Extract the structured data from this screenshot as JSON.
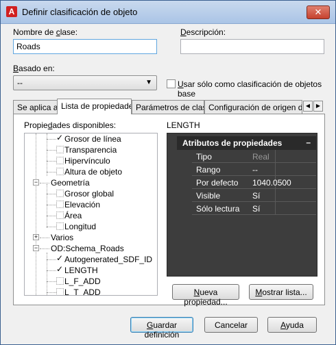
{
  "title": "Definir clasificación de objeto",
  "close_label": "✕",
  "class_name": {
    "label_pre": "Nombre de ",
    "label_u": "c",
    "label_post": "lase:",
    "value": "Roads"
  },
  "description": {
    "label_pre": "",
    "label_u": "D",
    "label_post": "escripción:",
    "value": ""
  },
  "based_on": {
    "label_pre": "",
    "label_u": "B",
    "label_post": "asado en:",
    "value": "--"
  },
  "base_only": {
    "label_pre": "",
    "label_u": "U",
    "label_post": "sar sólo como clasificación de objetos base",
    "checked": false
  },
  "tabs": [
    {
      "label": "Se aplica a"
    },
    {
      "label": "Lista de propiedades"
    },
    {
      "label": "Parámetros de clase"
    },
    {
      "label": "Configuración de origen de e"
    }
  ],
  "available_label_pre": "Propie",
  "available_label_u": "d",
  "available_label_post": "ades disponibles:",
  "tree": [
    {
      "label": "Grosor de línea",
      "checked": true
    },
    {
      "label": "Transparencia",
      "checked": false
    },
    {
      "label": "Hipervínculo",
      "checked": false
    },
    {
      "label": "Altura de objeto",
      "checked": false
    },
    {
      "label": "Geometría",
      "group": true,
      "expanded": true
    },
    {
      "label": "Grosor global",
      "checked": false
    },
    {
      "label": "Elevación",
      "checked": false
    },
    {
      "label": "Área",
      "checked": false
    },
    {
      "label": "Longitud",
      "checked": false
    },
    {
      "label": "Varios",
      "group": true,
      "expanded": false
    },
    {
      "label": "OD:Schema_Roads",
      "group": true,
      "expanded": true
    },
    {
      "label": "Autogenerated_SDF_ID",
      "checked": true
    },
    {
      "label": "LENGTH",
      "checked": true
    },
    {
      "label": "L_F_ADD",
      "checked": false
    },
    {
      "label": "L_T_ADD",
      "checked": false
    }
  ],
  "selected_property": "LENGTH",
  "attributes": {
    "header": "Atributos de propiedades",
    "collapse": "–",
    "rows": [
      {
        "name": "Tipo",
        "value": "Real",
        "disabled": true
      },
      {
        "name": "Rango",
        "value": "--"
      },
      {
        "name": "Por defecto",
        "value": "1040.0500"
      },
      {
        "name": "Visible",
        "value": "Sí"
      },
      {
        "name": "Sólo lectura",
        "value": "Sí"
      }
    ]
  },
  "buttons": {
    "new_property": {
      "pre": "",
      "u": "N",
      "post": "ueva propiedad..."
    },
    "show_list": {
      "pre": "",
      "u": "M",
      "post": "ostrar lista..."
    },
    "save": {
      "pre": "",
      "u": "G",
      "post": "uardar definición"
    },
    "cancel": "Cancelar",
    "help": {
      "pre": "",
      "u": "A",
      "post": "yuda"
    }
  }
}
